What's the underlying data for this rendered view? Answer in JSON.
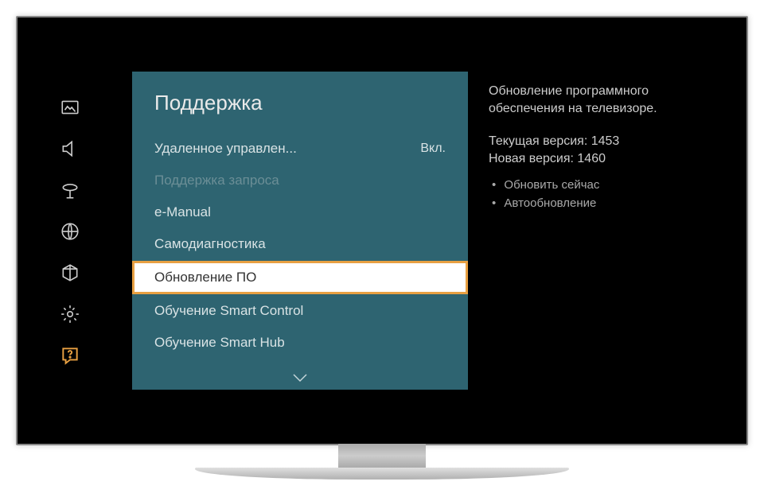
{
  "panel": {
    "title": "Поддержка"
  },
  "menu": {
    "items": [
      {
        "label": "Удаленное управлен...",
        "value": "Вкл.",
        "disabled": false,
        "highlighted": false
      },
      {
        "label": "Поддержка запроса",
        "value": "",
        "disabled": true,
        "highlighted": false
      },
      {
        "label": "e-Manual",
        "value": "",
        "disabled": false,
        "highlighted": false
      },
      {
        "label": "Самодиагностика",
        "value": "",
        "disabled": false,
        "highlighted": false
      },
      {
        "label": "Обновление ПО",
        "value": "",
        "disabled": false,
        "highlighted": true
      },
      {
        "label": "Обучение Smart Control",
        "value": "",
        "disabled": false,
        "highlighted": false
      },
      {
        "label": "Обучение Smart Hub",
        "value": "",
        "disabled": false,
        "highlighted": false
      }
    ]
  },
  "info": {
    "description": "Обновление программного обеспечения на телевизоре.",
    "current_version_label": "Текущая версия: 1453",
    "new_version_label": "Новая версия: 1460",
    "sub_items": [
      "Обновить сейчас",
      "Автообновление"
    ]
  },
  "sidebar": {
    "icons": [
      "picture-icon",
      "sound-icon",
      "broadcast-icon",
      "network-icon",
      "system-icon",
      "settings-icon",
      "support-icon"
    ]
  }
}
